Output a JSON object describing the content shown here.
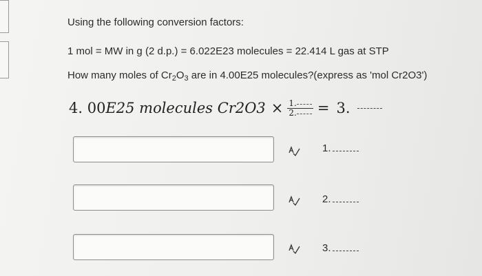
{
  "question": {
    "heading": "Using the following conversion factors:",
    "factors": "1 mol = MW in g (2 d.p.) = 6.022E23 molecules = 22.414 L gas at STP",
    "prompt_before": "How many moles of ",
    "formula_cr": "Cr",
    "formula_sub1": "2",
    "formula_o": "O",
    "formula_sub2": "3",
    "prompt_after": " are in 4.00E25 molecules?(express as 'mol Cr2O3')"
  },
  "equation": {
    "lhs_number": "4. 00",
    "lhs_units": "E25 molecules Cr2O3",
    "times": "×",
    "frac_num": "1.",
    "frac_den": "2.",
    "equals": "=",
    "result": "3."
  },
  "answers": [
    {
      "value": "",
      "label": "1."
    },
    {
      "value": "",
      "label": "2."
    },
    {
      "value": "",
      "label": "3."
    }
  ]
}
